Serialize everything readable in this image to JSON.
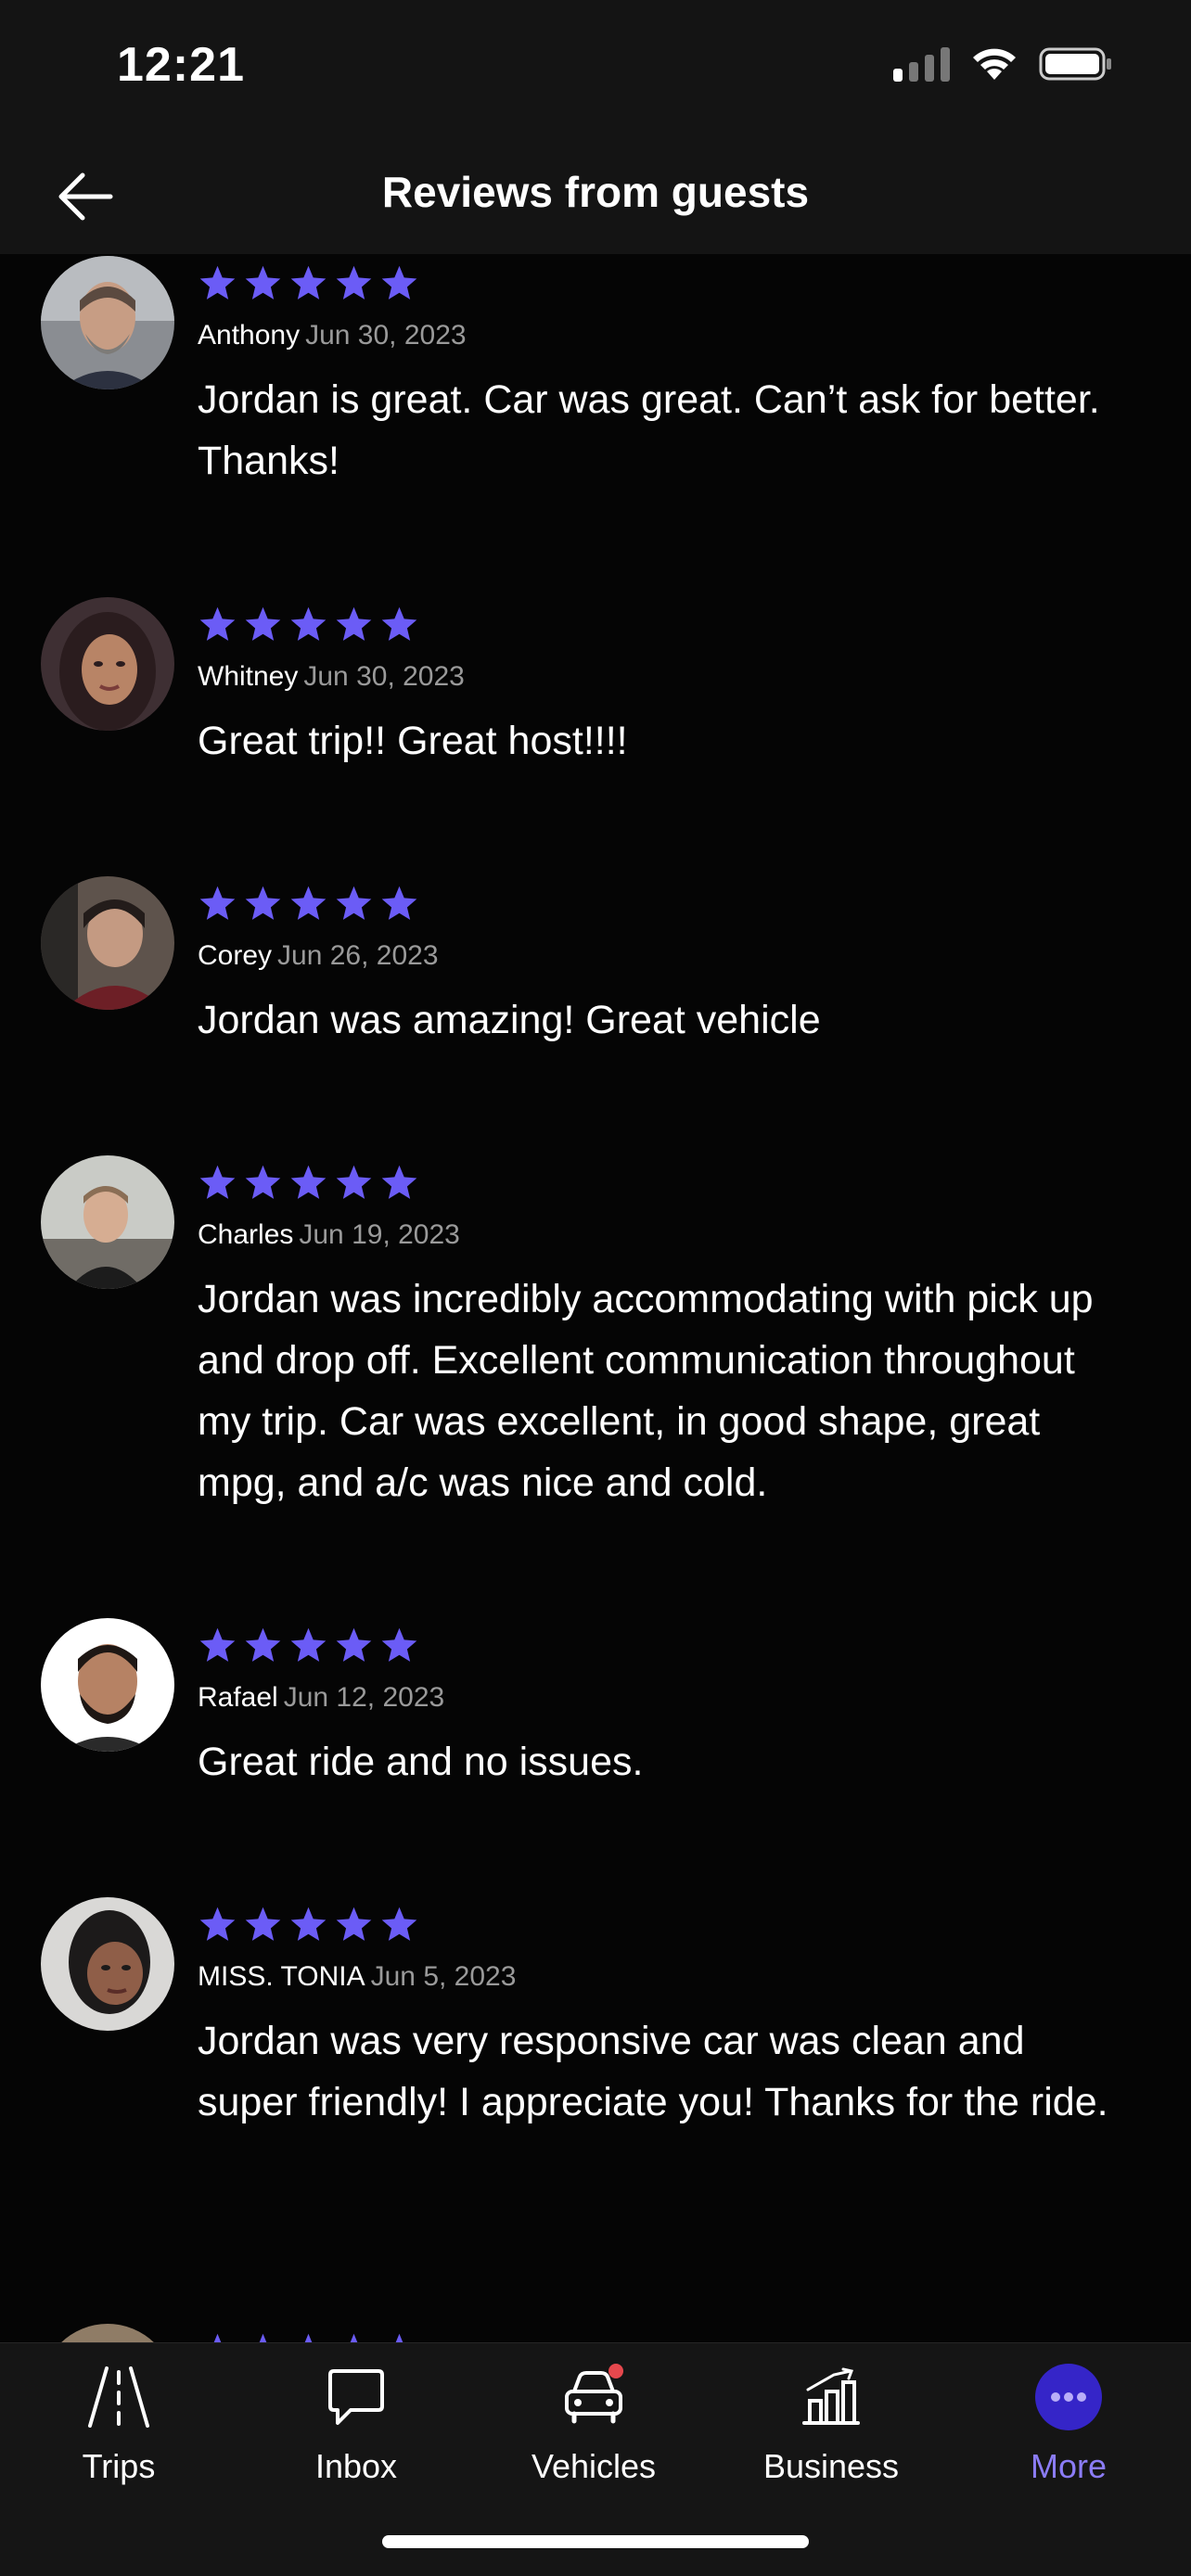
{
  "status_bar": {
    "time": "12:21"
  },
  "header": {
    "title": "Reviews from guests"
  },
  "colors": {
    "accent": "#6b5cf6",
    "background": "#050505",
    "bar": "#141414"
  },
  "reviews": [
    {
      "name": "Anthony",
      "date": "Jun 30, 2023",
      "rating": 5,
      "text": "Jordan is great. Car was great. Can’t ask for better. Thanks!"
    },
    {
      "name": "Whitney",
      "date": "Jun 30, 2023",
      "rating": 5,
      "text": "Great trip!! Great host!!!!"
    },
    {
      "name": "Corey",
      "date": "Jun 26, 2023",
      "rating": 5,
      "text": "Jordan was amazing! Great vehicle"
    },
    {
      "name": "Charles",
      "date": "Jun 19, 2023",
      "rating": 5,
      "text": "Jordan was incredibly accommodating with pick up and drop off. Excellent communication throughout my trip. Car was excellent, in good shape, great mpg, and a/c was nice and cold."
    },
    {
      "name": "Rafael",
      "date": "Jun 12, 2023",
      "rating": 5,
      "text": "Great ride and no issues."
    },
    {
      "name": "MISS. TONIA",
      "date": "Jun 5, 2023",
      "rating": 5,
      "text": "Jordan was very responsive car was clean and super friendly! I appreciate you! Thanks for the ride."
    },
    {
      "name": "",
      "date": "",
      "rating": 5,
      "text": ""
    }
  ],
  "tabs": [
    {
      "label": "Trips",
      "icon": "road-icon",
      "active": false
    },
    {
      "label": "Inbox",
      "icon": "chat-bubble-icon",
      "active": false
    },
    {
      "label": "Vehicles",
      "icon": "car-icon",
      "active": false,
      "badge": true
    },
    {
      "label": "Business",
      "icon": "chart-icon",
      "active": false
    },
    {
      "label": "More",
      "icon": "more-icon",
      "active": true
    }
  ]
}
